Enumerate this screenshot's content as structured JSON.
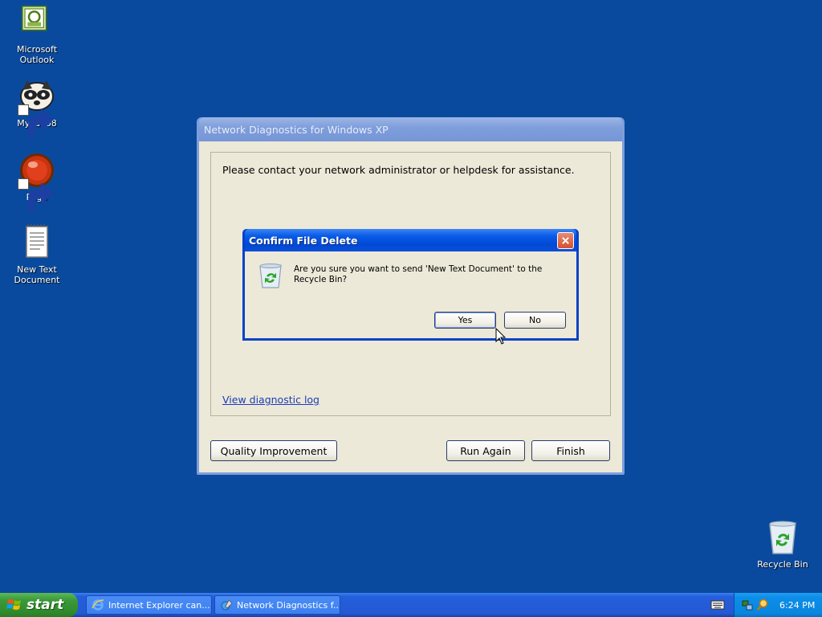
{
  "desktop": {
    "icons": [
      {
        "label": "Microsoft Outlook",
        "icon": "outlook-icon"
      },
      {
        "label": "MyPal 68",
        "icon": "mypal-raccoon-icon"
      },
      {
        "label": "Pego",
        "icon": "pego-red-ball-icon"
      },
      {
        "label": "New Text Document",
        "icon": "text-document-icon"
      },
      {
        "label": "Recycle Bin",
        "icon": "recycle-bin-icon"
      }
    ]
  },
  "main_window": {
    "title": "Network Diagnostics for Windows XP",
    "message": "Please contact your network administrator or helpdesk for assistance.",
    "link": "View diagnostic log",
    "buttons": {
      "quality": "Quality Improvement",
      "run_again": "Run Again",
      "finish": "Finish"
    }
  },
  "confirm_dialog": {
    "title": "Confirm File Delete",
    "message": "Are you sure you want to send 'New Text Document' to the Recycle Bin?",
    "buttons": {
      "yes": "Yes",
      "no": "No"
    },
    "icon": "recycle-bin-icon"
  },
  "taskbar": {
    "start_label": "start",
    "tasks": [
      {
        "label": "Internet Explorer can...",
        "icon": "internet-explorer-icon"
      },
      {
        "label": "Network Diagnostics f...",
        "icon": "network-diagnostics-icon"
      }
    ],
    "clock": "6:24 PM"
  },
  "colors": {
    "desktop_bg": "#0a4a9e",
    "titlebar_active": "#0a5ce7",
    "titlebar_inactive": "#7f9edb",
    "window_face": "#ece9d8",
    "start_green": "#3c9a39",
    "link": "#1d3cb8"
  }
}
